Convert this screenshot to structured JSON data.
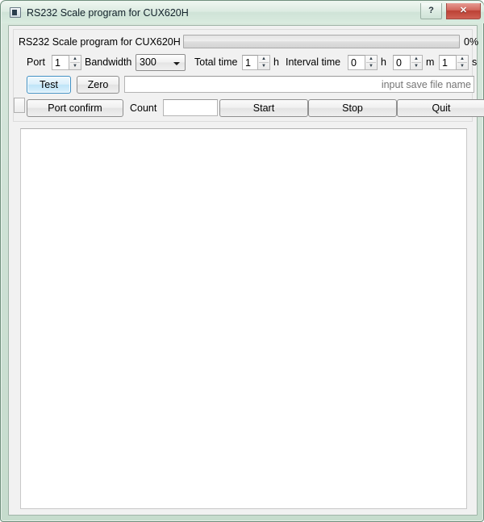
{
  "window": {
    "title": "RS232 Scale program for CUX620H",
    "app_icon": "application-icon",
    "help_label": "?",
    "close_label": "✕",
    "accent_close_color": "#bc4135",
    "frame_color": "#cfe2d6"
  },
  "progress": {
    "label": "RS232 Scale program for CUX620H",
    "percent_text": "0%",
    "value": 0
  },
  "fields": {
    "port_label": "Port",
    "port_value": "1",
    "bandwidth_label": "Bandwidth",
    "bandwidth_value": "300",
    "bandwidth_options": [
      "300"
    ],
    "total_time_label": "Total time",
    "total_time_value": "1",
    "total_time_unit": "h",
    "interval_time_label": "Interval time",
    "interval_hours_value": "0",
    "interval_hours_unit": "h",
    "interval_minutes_value": "0",
    "interval_minutes_unit": "m",
    "interval_seconds_value": "1",
    "interval_seconds_unit": "s"
  },
  "actions": {
    "test_label": "Test",
    "zero_label": "Zero",
    "filename_placeholder": "input save file name",
    "filename_value": "",
    "port_confirm_label": "Port confirm",
    "count_label": "Count",
    "count_value": "",
    "start_label": "Start",
    "stop_label": "Stop",
    "quit_label": "Quit"
  },
  "output": {
    "text": ""
  }
}
